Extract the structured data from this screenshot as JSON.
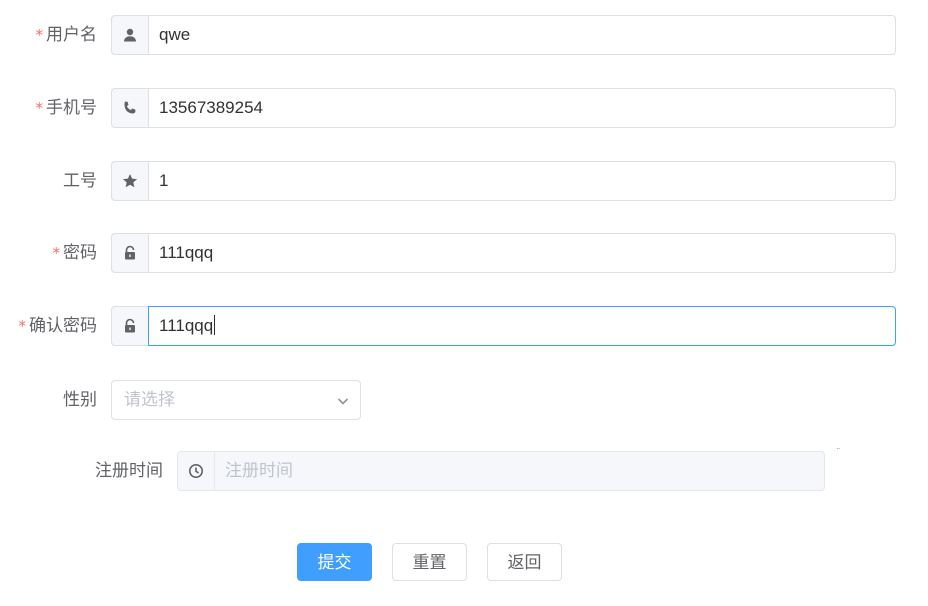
{
  "form": {
    "username": {
      "label": "用户名",
      "required": true,
      "value": "qwe",
      "icon": "user-icon"
    },
    "phone": {
      "label": "手机号",
      "required": true,
      "value": "13567389254",
      "icon": "phone-icon"
    },
    "employee_id": {
      "label": "工号",
      "required": false,
      "value": "1",
      "icon": "star-icon"
    },
    "password": {
      "label": "密码",
      "required": true,
      "value": "111qqq",
      "icon": "lock-icon"
    },
    "confirm_password": {
      "label": "确认密码",
      "required": true,
      "value": "111qqq",
      "icon": "lock-icon"
    },
    "gender": {
      "label": "性别",
      "placeholder": "请选择",
      "icon": "chevron-down-icon"
    },
    "register_time": {
      "label": "注册时间",
      "placeholder": "注册时间",
      "disabled": true,
      "icon": "clock-icon"
    }
  },
  "required_mark": "*",
  "buttons": {
    "submit": "提交",
    "reset": "重置",
    "back": "返回"
  },
  "colors": {
    "primary": "#409eff",
    "required": "#f56c6c",
    "border": "#dcdfe6",
    "prepend_bg": "#f5f7fa"
  }
}
